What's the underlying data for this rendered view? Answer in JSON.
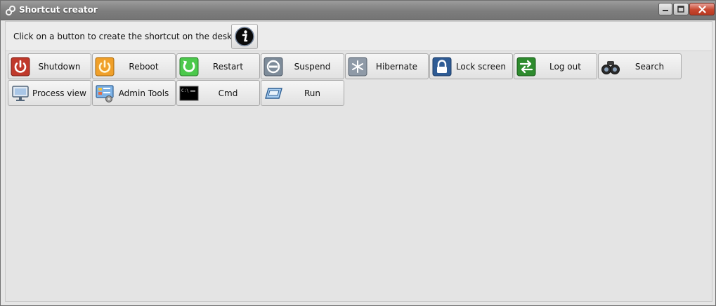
{
  "window": {
    "title": "Shortcut creator",
    "app_icon": "chain-link-icon",
    "controls": [
      "minimize-icon",
      "maximize-icon",
      "close-icon"
    ]
  },
  "instructions": "Click on a button to create the shortcut on the desktop",
  "info_button": {
    "icon": "info-icon"
  },
  "shortcuts": [
    {
      "label": "Shutdown",
      "icon": "power-icon"
    },
    {
      "label": "Reboot",
      "icon": "reboot-icon"
    },
    {
      "label": "Restart",
      "icon": "restart-icon"
    },
    {
      "label": "Suspend",
      "icon": "suspend-icon"
    },
    {
      "label": "Hibernate",
      "icon": "hibernate-icon"
    },
    {
      "label": "Lock screen",
      "icon": "padlock-icon"
    },
    {
      "label": "Log out",
      "icon": "logout-arrows-icon"
    },
    {
      "label": "Search",
      "icon": "binoculars-icon"
    },
    {
      "label": "Process view",
      "icon": "monitor-icon"
    },
    {
      "label": "Admin Tools",
      "icon": "admin-panel-icon"
    },
    {
      "label": "Cmd",
      "icon": "terminal-icon"
    },
    {
      "label": "Run",
      "icon": "run-window-icon"
    }
  ],
  "colors": {
    "titlebar": "#838383",
    "close_button": "#c8472f",
    "shutdown_red": "#c0392b",
    "reboot_orange": "#f0a02a",
    "restart_green": "#4cc94c",
    "logout_green": "#2e8b2e",
    "lock_blue": "#2f5c95"
  }
}
